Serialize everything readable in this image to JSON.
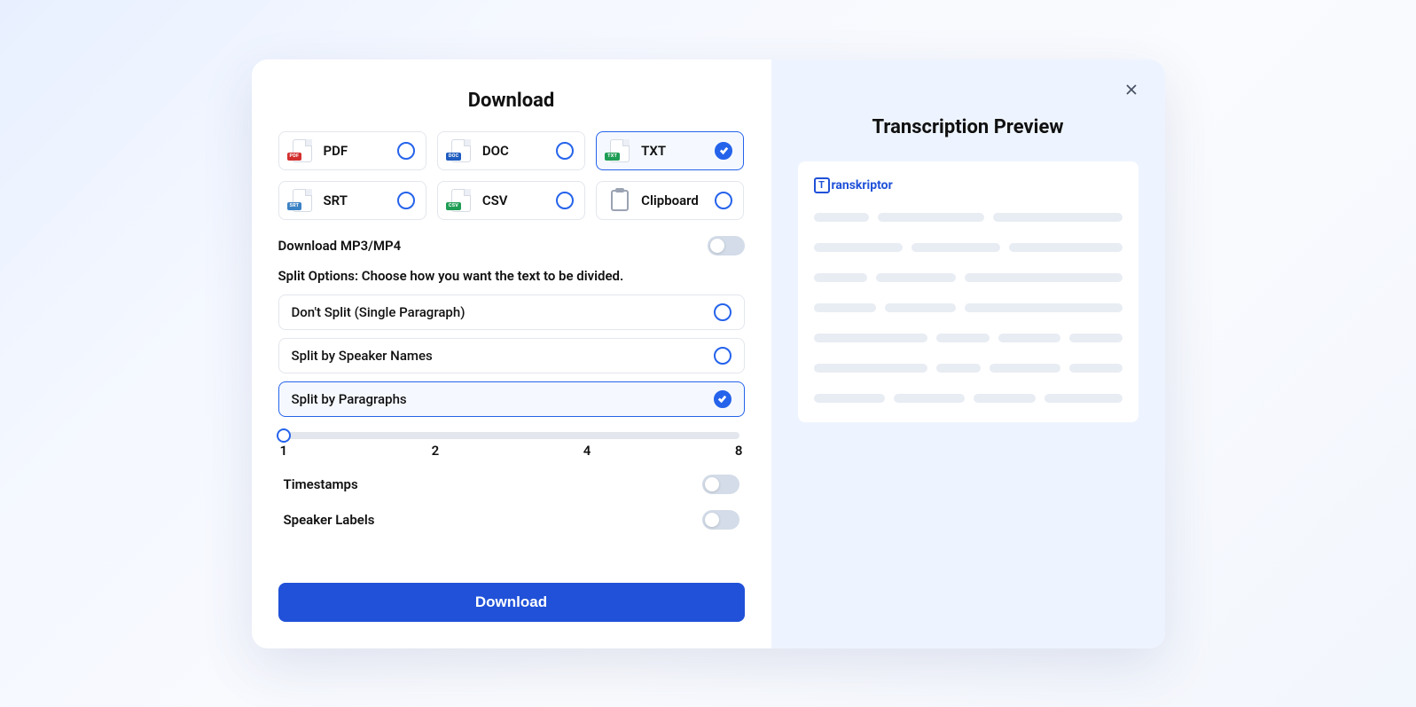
{
  "left": {
    "title": "Download",
    "formats": [
      {
        "label": "PDF",
        "tag": "PDF",
        "tagClass": "tag-pdf",
        "selected": false
      },
      {
        "label": "DOC",
        "tag": "DOC",
        "tagClass": "tag-doc",
        "selected": false
      },
      {
        "label": "TXT",
        "tag": "TXT",
        "tagClass": "tag-txt",
        "selected": true
      },
      {
        "label": "SRT",
        "tag": "SRT",
        "tagClass": "tag-srt",
        "selected": false
      },
      {
        "label": "CSV",
        "tag": "CSV",
        "tagClass": "tag-csv",
        "selected": false
      },
      {
        "label": "Clipboard",
        "tag": "",
        "tagClass": "clipboard",
        "selected": false
      }
    ],
    "downloadMediaLabel": "Download MP3/MP4",
    "downloadMediaOn": false,
    "splitHeader": "Split Options: Choose how you want the text to be divided.",
    "splitOptions": [
      {
        "label": "Don't Split (Single Paragraph)",
        "selected": false
      },
      {
        "label": "Split by Speaker Names",
        "selected": false
      },
      {
        "label": "Split by Paragraphs",
        "selected": true
      }
    ],
    "slider": {
      "value": 1,
      "ticks": [
        "1",
        "2",
        "4",
        "8"
      ]
    },
    "timestampsLabel": "Timestamps",
    "timestampsOn": false,
    "speakerLabelsLabel": "Speaker Labels",
    "speakerLabelsOn": false,
    "downloadButton": "Download"
  },
  "right": {
    "title": "Transcription Preview",
    "brandMark": "T",
    "brandText": "ranskriptor"
  }
}
